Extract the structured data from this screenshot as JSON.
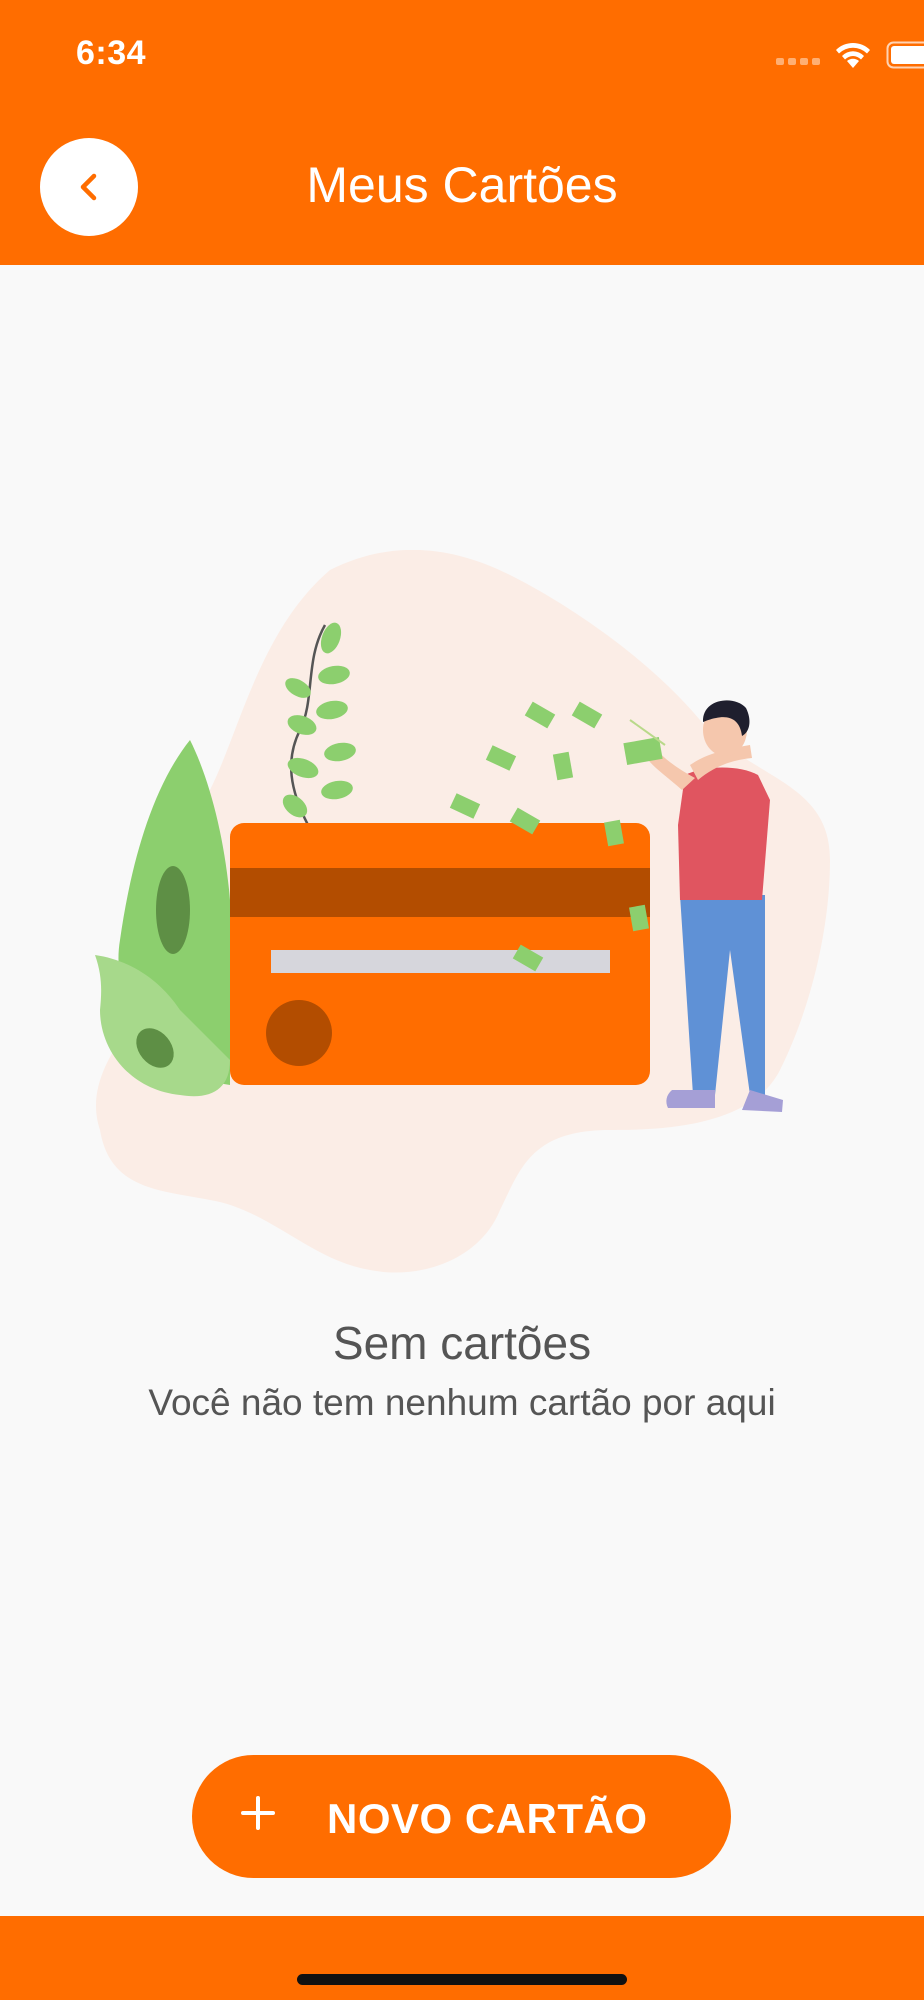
{
  "status_bar": {
    "time": "6:34",
    "icons": [
      "signal-icon",
      "wifi-icon",
      "battery-icon"
    ]
  },
  "header": {
    "title": "Meus Cartões",
    "back_icon": "chevron-left-icon",
    "background_color": "#ff6d00"
  },
  "empty_state": {
    "illustration": "credit-card-with-money-illustration",
    "title": "Sem cartões",
    "subtitle": "Você não tem nenhum cartão por aqui"
  },
  "actions": {
    "new_card_icon": "plus-icon",
    "new_card_label": "NOVO CARTÃO"
  },
  "colors": {
    "accent": "#ff6d00",
    "text": "#555555",
    "background": "#f9f9f9"
  }
}
